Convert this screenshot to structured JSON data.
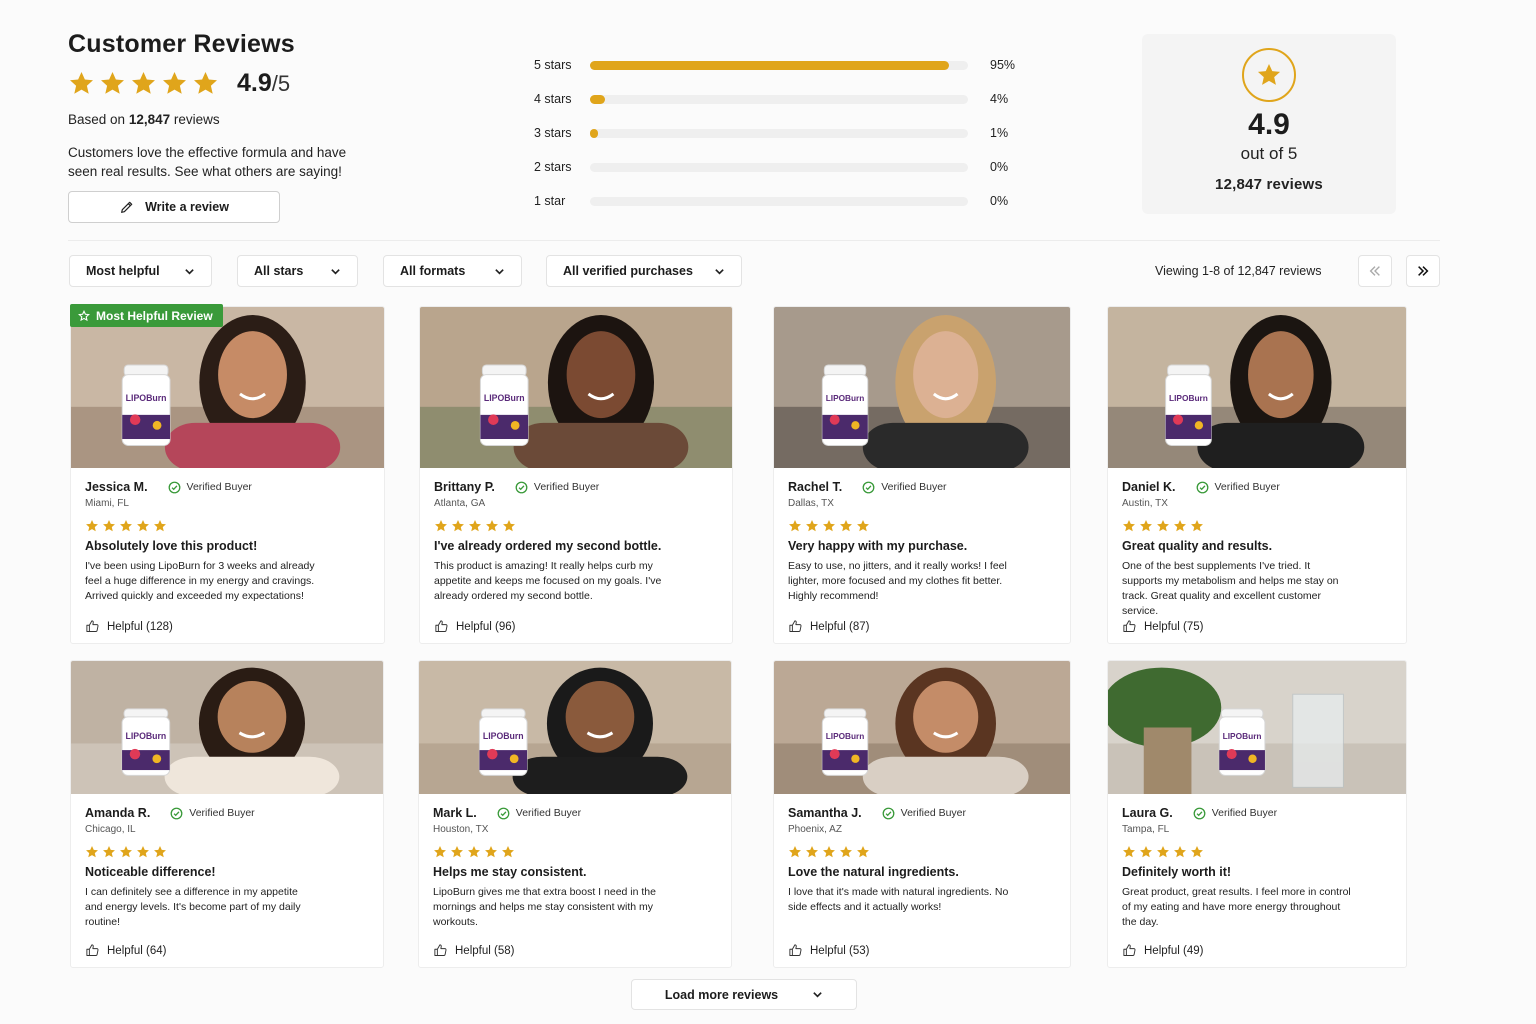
{
  "header": {
    "title": "Customer Reviews",
    "rating": "4.9",
    "rating_max": "/5",
    "based_on_prefix": "Based on",
    "based_on_count": "12,847",
    "based_on_suffix": "reviews",
    "tagline": "Customers love the effective formula and have seen real results. See what others are saying!",
    "write_review": "Write a review",
    "star_count": 5
  },
  "distribution": [
    {
      "label": "5 stars",
      "pct": "95%",
      "fraction": 0.95
    },
    {
      "label": "4 stars",
      "pct": "4%",
      "fraction": 0.04
    },
    {
      "label": "3 stars",
      "pct": "1%",
      "fraction": 0.01
    },
    {
      "label": "2 stars",
      "pct": "0%",
      "fraction": 0
    },
    {
      "label": "1 star",
      "pct": "0%",
      "fraction": 0
    }
  ],
  "score_card": {
    "value": "4.9",
    "out_of": "out of 5",
    "count": "12,847 reviews"
  },
  "filters": {
    "sort": "Most helpful",
    "stars": "All stars",
    "formats": "All formats",
    "purchases": "All verified purchases",
    "viewing": "Viewing 1-8 of 12,847 reviews"
  },
  "badge": "Most Helpful Review",
  "verified_label": "Verified Buyer",
  "reviews": [
    {
      "name": "Jessica M.",
      "location": "Miami, FL",
      "title": "Absolutely love this product!",
      "text": "I've been using LipoBurn for 3 weeks and already feel a huge difference in my energy and cravings. Arrived quickly and exceeded my expectations!",
      "helpful": "Helpful (128)"
    },
    {
      "name": "Brittany P.",
      "location": "Atlanta, GA",
      "title": "I've already ordered my second bottle.",
      "text": "This product is amazing! It really helps curb my appetite and keeps me focused on my goals. I've already ordered my second bottle.",
      "helpful": "Helpful (96)"
    },
    {
      "name": "Rachel T.",
      "location": "Dallas, TX",
      "title": "Very happy with my purchase.",
      "text": "Easy to use, no jitters, and it really works! I feel lighter, more focused and my clothes fit better. Highly recommend!",
      "helpful": "Helpful (87)"
    },
    {
      "name": "Daniel K.",
      "location": "Austin, TX",
      "title": "Great quality and results.",
      "text": "One of the best supplements I've tried. It supports my metabolism and helps me stay on track. Great quality and excellent customer service.",
      "helpful": "Helpful (75)"
    },
    {
      "name": "Amanda R.",
      "location": "Chicago, IL",
      "title": "Noticeable difference!",
      "text": "I can definitely see a difference in my appetite and energy levels. It's become part of my daily routine!",
      "helpful": "Helpful (64)"
    },
    {
      "name": "Mark L.",
      "location": "Houston, TX",
      "title": "Helps me stay consistent.",
      "text": "LipoBurn gives me that extra boost I need in the mornings and helps me stay consistent with my workouts.",
      "helpful": "Helpful (58)"
    },
    {
      "name": "Samantha J.",
      "location": "Phoenix, AZ",
      "title": "Love the natural ingredients.",
      "text": "I love that it's made with natural ingredients. No side effects and it actually works!",
      "helpful": "Helpful (53)"
    },
    {
      "name": "Laura G.",
      "location": "Tampa, FL",
      "title": "Definitely worth it!",
      "text": "Great product, great results. I feel more in control of my eating and have more energy throughout the day.",
      "helpful": "Helpful (49)"
    }
  ],
  "bottle_label": "LIPOBurn",
  "load_more": "Load more reviews",
  "colors": {
    "accent": "#e0a51b",
    "verified": "#3a9a3a",
    "badge": "#3a9a3a"
  }
}
